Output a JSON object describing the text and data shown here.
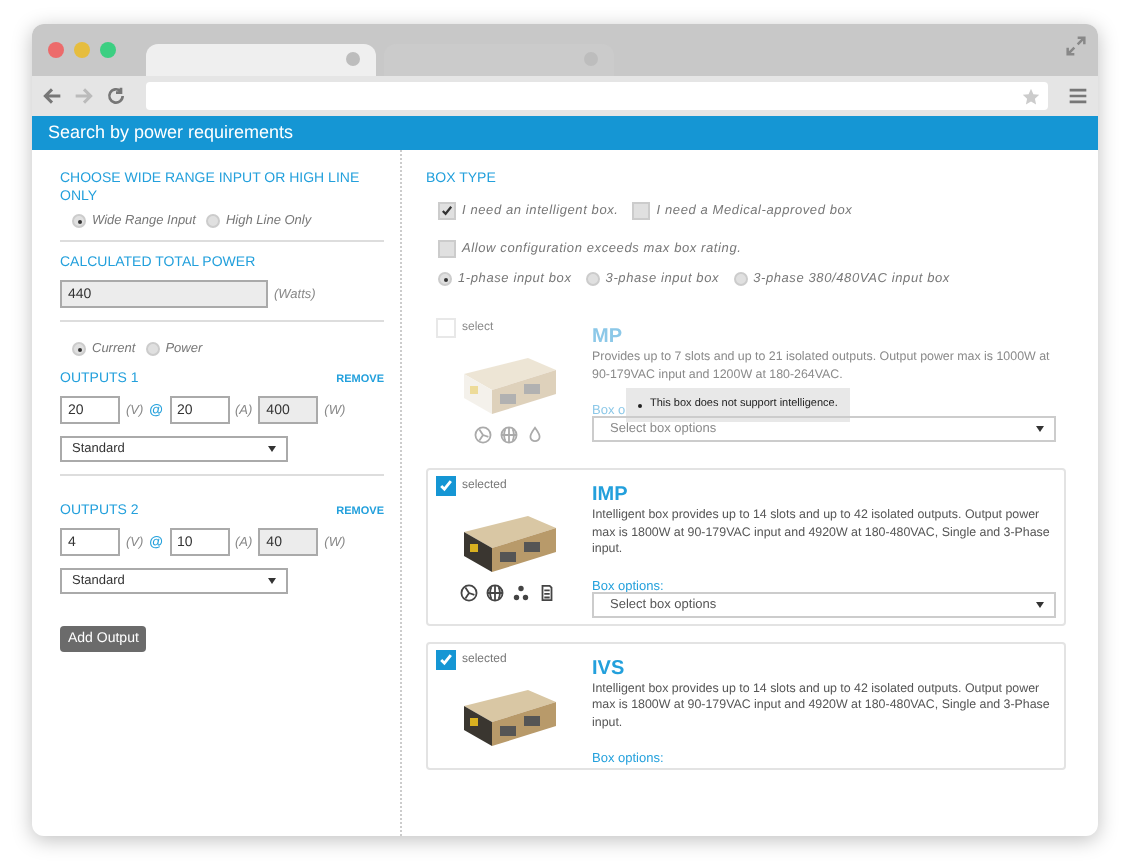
{
  "browser": {
    "tabs": [
      {
        "selected": true
      },
      {
        "selected": false
      }
    ]
  },
  "header": {
    "title": "Search by power requirements"
  },
  "input_range": {
    "heading": "CHOOSE WIDE RANGE INPUT OR HIGH LINE ONLY",
    "options": [
      {
        "label": "Wide Range Input",
        "selected": true
      },
      {
        "label": "High Line Only",
        "selected": false
      }
    ]
  },
  "total_power": {
    "heading": "CALCULATED TOTAL POWER",
    "value": "440",
    "unit": "(Watts)"
  },
  "mode": [
    {
      "label": "Current",
      "selected": true
    },
    {
      "label": "Power",
      "selected": false
    }
  ],
  "outputs": [
    {
      "title": "OUTPUTS 1",
      "remove": "REMOVE",
      "voltage": "20",
      "voltage_unit": "(V)",
      "at": "@",
      "current": "20",
      "current_unit": "(A)",
      "power": "400",
      "power_unit": "(W)",
      "type": "Standard"
    },
    {
      "title": "OUTPUTS 2",
      "remove": "REMOVE",
      "voltage": "4",
      "voltage_unit": "(V)",
      "at": "@",
      "current": "10",
      "current_unit": "(A)",
      "power": "40",
      "power_unit": "(W)",
      "type": "Standard"
    }
  ],
  "add_button": "Add Output",
  "box_type": {
    "heading": "BOX TYPE",
    "checks": [
      {
        "label": "I need an intelligent box.",
        "checked": true
      },
      {
        "label": "I need a Medical-approved box",
        "checked": false
      },
      {
        "label": "Allow configuration exceeds max box rating.",
        "checked": false
      }
    ],
    "phases": [
      {
        "label": "1-phase input box",
        "selected": true
      },
      {
        "label": "3-phase input box",
        "selected": false
      },
      {
        "label": "3-phase 380/480VAC input box",
        "selected": false
      }
    ]
  },
  "boxes": [
    {
      "name": "MP",
      "disabled": true,
      "selected": false,
      "select_label": "select",
      "description": "Provides up to 7 slots and up to 21 isolated outputs. Output power max is 1000W at 90-179VAC input and 1200W at 180-264VAC.",
      "options_label": "Box o",
      "options_placeholder": "Select box options",
      "tooltip": "This box does not support intelligence.",
      "icons": [
        {
          "kind": "fan"
        },
        {
          "kind": "globe"
        },
        {
          "kind": "drop"
        }
      ]
    },
    {
      "name": "IMP",
      "disabled": false,
      "selected": true,
      "select_label": "selected",
      "description": "Intelligent box provides up to 14 slots and up to 42 isolated outputs. Output power max is 1800W at 90-179VAC input and 4920W at 180-480VAC, Single and 3-Phase input.",
      "options_label": "Box options:",
      "options_placeholder": "Select box options",
      "icons": [
        {
          "kind": "fan"
        },
        {
          "kind": "globe"
        },
        {
          "kind": "nodes"
        },
        {
          "kind": "doc"
        }
      ]
    },
    {
      "name": "IVS",
      "disabled": false,
      "selected": true,
      "select_label": "selected",
      "description": "Intelligent box provides up to 14 slots and up to 42 isolated outputs. Output power max is 1800W at 90-179VAC input and 4920W at 180-480VAC, Single and 3-Phase input.",
      "options_label": "Box options:"
    }
  ]
}
